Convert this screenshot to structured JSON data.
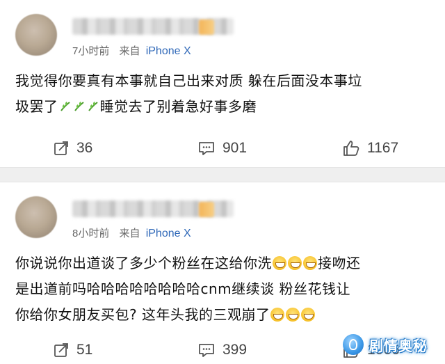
{
  "posts": [
    {
      "time": "7小时前",
      "source_prefix": "来自",
      "device": "iPhone X",
      "content": {
        "line1": "我觉得你要真有本事就自己出来对质 躲在后面没本事垃",
        "line2_before": "圾罢了",
        "line2_after": "睡觉去了别着急好事多磨"
      },
      "actions": {
        "reposts": "36",
        "comments": "901",
        "likes": "1167"
      }
    },
    {
      "time": "8小时前",
      "source_prefix": "来自",
      "device": "iPhone X",
      "content": {
        "line1_before": "你说说你出道谈了多少个粉丝在这给你洗",
        "line1_after": "接吻还",
        "line2": "是出道前吗哈哈哈哈哈哈哈哈cnm继续谈 粉丝花钱让",
        "line3_before": "你给你女朋友买包? 这年头我的三观崩了"
      },
      "actions": {
        "reposts": "51",
        "comments": "399",
        "likes": "1066"
      }
    }
  ],
  "watermark": {
    "text": "剧情奥秘"
  },
  "icons": {
    "repost": "repost-icon",
    "comment": "comment-icon",
    "like": "thumbs-up-icon",
    "leaf_emoji": "leaf-emoji-icon",
    "smile_emoji": "grin-emoji-icon"
  },
  "colors": {
    "device_link": "#2f68b8",
    "divider": "#efefef",
    "watermark": "#3a97e6"
  }
}
